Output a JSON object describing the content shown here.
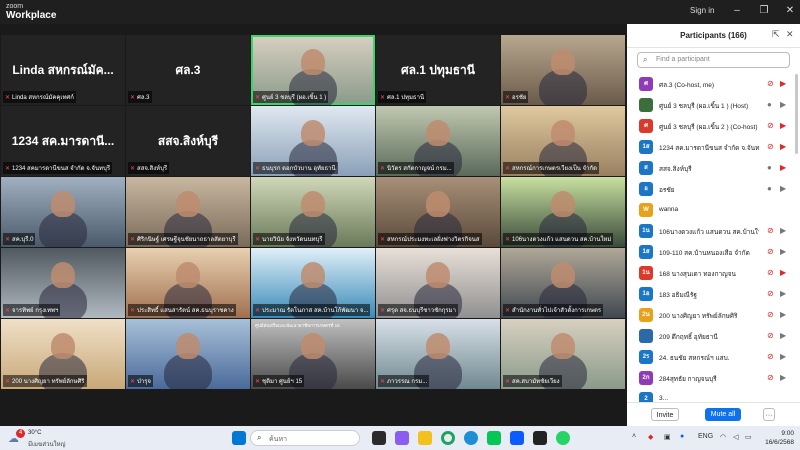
{
  "app": {
    "logo_line1": "zoom",
    "logo_line2": "Workplace",
    "signin": "Sign in"
  },
  "gallery": [
    {
      "big": "Linda สหกรณ์มัค...",
      "caption": "Linda สหกรณ์มัคคุเทศก์",
      "video": false
    },
    {
      "big": "ศล.3",
      "caption": "ศล.3",
      "video": false
    },
    {
      "big": "",
      "caption": "ศูนย์ 3 ชลบุรี (ผอ.เขิ้น 1 )",
      "video": true,
      "active": true
    },
    {
      "big": "ศล.1 ปทุมธานี",
      "caption": "ศล.1 ปทุมธานี",
      "video": false
    },
    {
      "big": "",
      "caption": "อรชัย",
      "video": true
    },
    {
      "big": "1234 สค.มารดานี...",
      "caption": "1234 สคมารดานีขนส จำกัด จ.จันทบุรี",
      "video": false
    },
    {
      "big": "สสจ.สิงห์บุรี",
      "caption": "สสจ.สิงห์บุรี",
      "video": false
    },
    {
      "big": "",
      "caption": "ธนบุรก ดอกบัวบาน อุทัยธานี",
      "video": true
    },
    {
      "big": "",
      "caption": "นิวัตร สกัดกาญจน์ กรม...",
      "video": true
    },
    {
      "big": "",
      "caption": "สหกรณ์การเกษตรเวียงเป็น จำกัด",
      "video": true
    },
    {
      "big": "",
      "caption": "สค.บุรี.0",
      "video": true
    },
    {
      "big": "",
      "caption": "ศิริกนิษฐ์ เศรษฐีจุนชัยนาถธาลสัตยาบุรี",
      "video": true
    },
    {
      "big": "",
      "caption": "นายวินัย จังหวัดนนทบุรี",
      "video": true
    },
    {
      "big": "",
      "caption": "สหกรณ์ประมงทะเลฝั่งฟางวิตรกิจนส",
      "video": true
    },
    {
      "big": "",
      "caption": "106นางดวงแก้ว แสนดวน สค.บ้านใหม่",
      "video": true
    },
    {
      "big": "",
      "caption": "จารทิพย์ กรุงเทพฯ",
      "video": true
    },
    {
      "big": "",
      "caption": "ประสิทธิ์ แสนสารัตน์ สค.ธนบุราชคาง",
      "video": true
    },
    {
      "big": "",
      "caption": "ประมาณ รัตโนภาส สค.บ้านโก้พัฒนา จ...",
      "video": true
    },
    {
      "big": "",
      "caption": "ศรุต สจ.ธนบุรีชาวชักกุรมา",
      "video": true
    },
    {
      "big": "",
      "caption": "สำนักงานทั่วไปเจ้าสัวตั้งการเกษตร",
      "video": true
    },
    {
      "big": "",
      "caption": "200 นางศิญยา ทรัพย์ลักษศิริ",
      "video": true
    },
    {
      "big": "",
      "caption": "ป่ารุจ",
      "video": true
    },
    {
      "big": "",
      "caption": "ชุติมา ศูนย์ฯ 15",
      "video": true
    },
    {
      "big": "",
      "caption": "ภาวรรณ กรม...",
      "video": true
    },
    {
      "big": "",
      "caption": "สค.สบามัทชัยเวียง",
      "video": true
    }
  ],
  "banner_text": "ศูนย์ส่งเสริมและพัฒนาอาชีพการเกษตรที่ 15",
  "participants": {
    "title": "Participants (166)",
    "search_placeholder": "Find a participant",
    "items": [
      {
        "avatar": "ศ",
        "name": "ศล.3 (Co-host, me)",
        "color": "#8e3bb6",
        "mic": "muted",
        "cam": "off"
      },
      {
        "avatar": "",
        "name": "ศูนย์ 3 ชลบุรี (ผอ.เขิ้น 1 ) (Host)",
        "color": "#3a6e3a",
        "mic": "on",
        "cam": "on"
      },
      {
        "avatar": "ศ",
        "name": "ศูนย์ 3 ชลบุรี (ผอ.เขิ้น 2 ) (Co-host)",
        "color": "#d93a2b",
        "mic": "muted",
        "cam": "off"
      },
      {
        "avatar": "1ส",
        "name": "1234 สค.มารดานีขนส จำกัด จ.จันทบุรี",
        "color": "#1b77c5",
        "mic": "muted",
        "cam": "off"
      },
      {
        "avatar": "ส",
        "name": "สสจ.สิงห์บุรี",
        "color": "#1b77c5",
        "mic": "on",
        "cam": "off"
      },
      {
        "avatar": "อ",
        "name": "อรชัย",
        "color": "#1b77c5",
        "mic": "on",
        "cam": "on"
      },
      {
        "avatar": "W",
        "name": "wanna",
        "color": "#e8a21a",
        "mic": "",
        "cam": ""
      },
      {
        "avatar": "1น",
        "name": "106นางดวงแก้ว แสนดวน สค.บ้านใหม่...",
        "color": "#1b77c5",
        "mic": "muted",
        "cam": "on"
      },
      {
        "avatar": "1ส",
        "name": "109-110 สค.บ้านหนองเสือ จำกัด",
        "color": "#1b77c5",
        "mic": "muted",
        "cam": "on"
      },
      {
        "avatar": "1น",
        "name": "168 นางสุนเดา ทองกาญจน",
        "color": "#d93a2b",
        "mic": "muted",
        "cam": "off"
      },
      {
        "avatar": "1อ",
        "name": "183 อธิมณีรัฐ",
        "color": "#1b77c5",
        "mic": "muted",
        "cam": "on"
      },
      {
        "avatar": "2น",
        "name": "200 นางศิญยา ทรัพย์ลักษศิริ",
        "color": "#e8a21a",
        "mic": "muted",
        "cam": "on"
      },
      {
        "avatar": "",
        "name": "209 ดึกฤทธิ์ อุทัยธานี",
        "color": "#2b6aa8",
        "mic": "muted",
        "cam": "on"
      },
      {
        "avatar": "2ร",
        "name": "24. ธนชัย สหกรณ์ฯ แสบ.",
        "color": "#1b77c5",
        "mic": "muted",
        "cam": "on"
      },
      {
        "avatar": "2ก",
        "name": "284สุทธัย กาญจนบุรี",
        "color": "#8e3bb6",
        "mic": "muted",
        "cam": "on"
      },
      {
        "avatar": "2",
        "name": "3...",
        "color": "#1b77c5",
        "mic": "",
        "cam": ""
      }
    ],
    "invite": "Invite",
    "mute_all": "Mute all",
    "more": "···"
  },
  "taskbar": {
    "badge": "4",
    "temp": "30°C",
    "weather": "มีเมฆส่วนใหญ่",
    "search_placeholder": "ค้นหา",
    "lang": "ENG",
    "time": "9:00",
    "date": "16/6/2568"
  }
}
